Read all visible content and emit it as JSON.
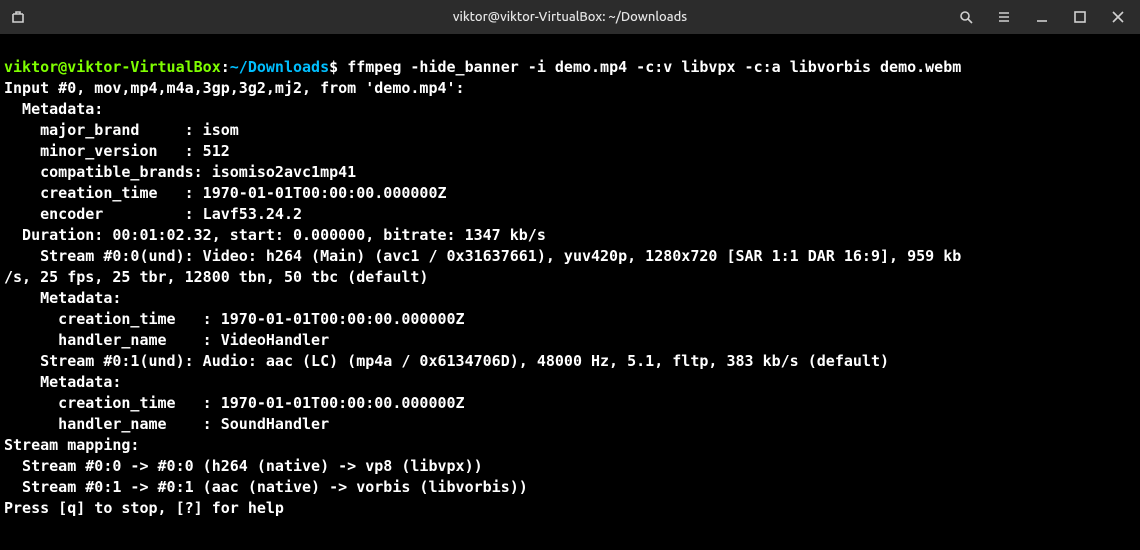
{
  "window": {
    "title": "viktor@viktor-VirtualBox: ~/Downloads"
  },
  "prompt": {
    "user_host": "viktor@viktor-VirtualBox",
    "colon": ":",
    "path": "~/Downloads",
    "symbol": "$ "
  },
  "command": "ffmpeg -hide_banner -i demo.mp4 -c:v libvpx -c:a libvorbis demo.webm",
  "output_lines": [
    "Input #0, mov,mp4,m4a,3gp,3g2,mj2, from 'demo.mp4':",
    "  Metadata:",
    "    major_brand     : isom",
    "    minor_version   : 512",
    "    compatible_brands: isomiso2avc1mp41",
    "    creation_time   : 1970-01-01T00:00:00.000000Z",
    "    encoder         : Lavf53.24.2",
    "  Duration: 00:01:02.32, start: 0.000000, bitrate: 1347 kb/s",
    "    Stream #0:0(und): Video: h264 (Main) (avc1 / 0x31637661), yuv420p, 1280x720 [SAR 1:1 DAR 16:9], 959 kb",
    "/s, 25 fps, 25 tbr, 12800 tbn, 50 tbc (default)",
    "    Metadata:",
    "      creation_time   : 1970-01-01T00:00:00.000000Z",
    "      handler_name    : VideoHandler",
    "    Stream #0:1(und): Audio: aac (LC) (mp4a / 0x6134706D), 48000 Hz, 5.1, fltp, 383 kb/s (default)",
    "    Metadata:",
    "      creation_time   : 1970-01-01T00:00:00.000000Z",
    "      handler_name    : SoundHandler",
    "Stream mapping:",
    "  Stream #0:0 -> #0:0 (h264 (native) -> vp8 (libvpx))",
    "  Stream #0:1 -> #0:1 (aac (native) -> vorbis (libvorbis))",
    "Press [q] to stop, [?] for help"
  ]
}
